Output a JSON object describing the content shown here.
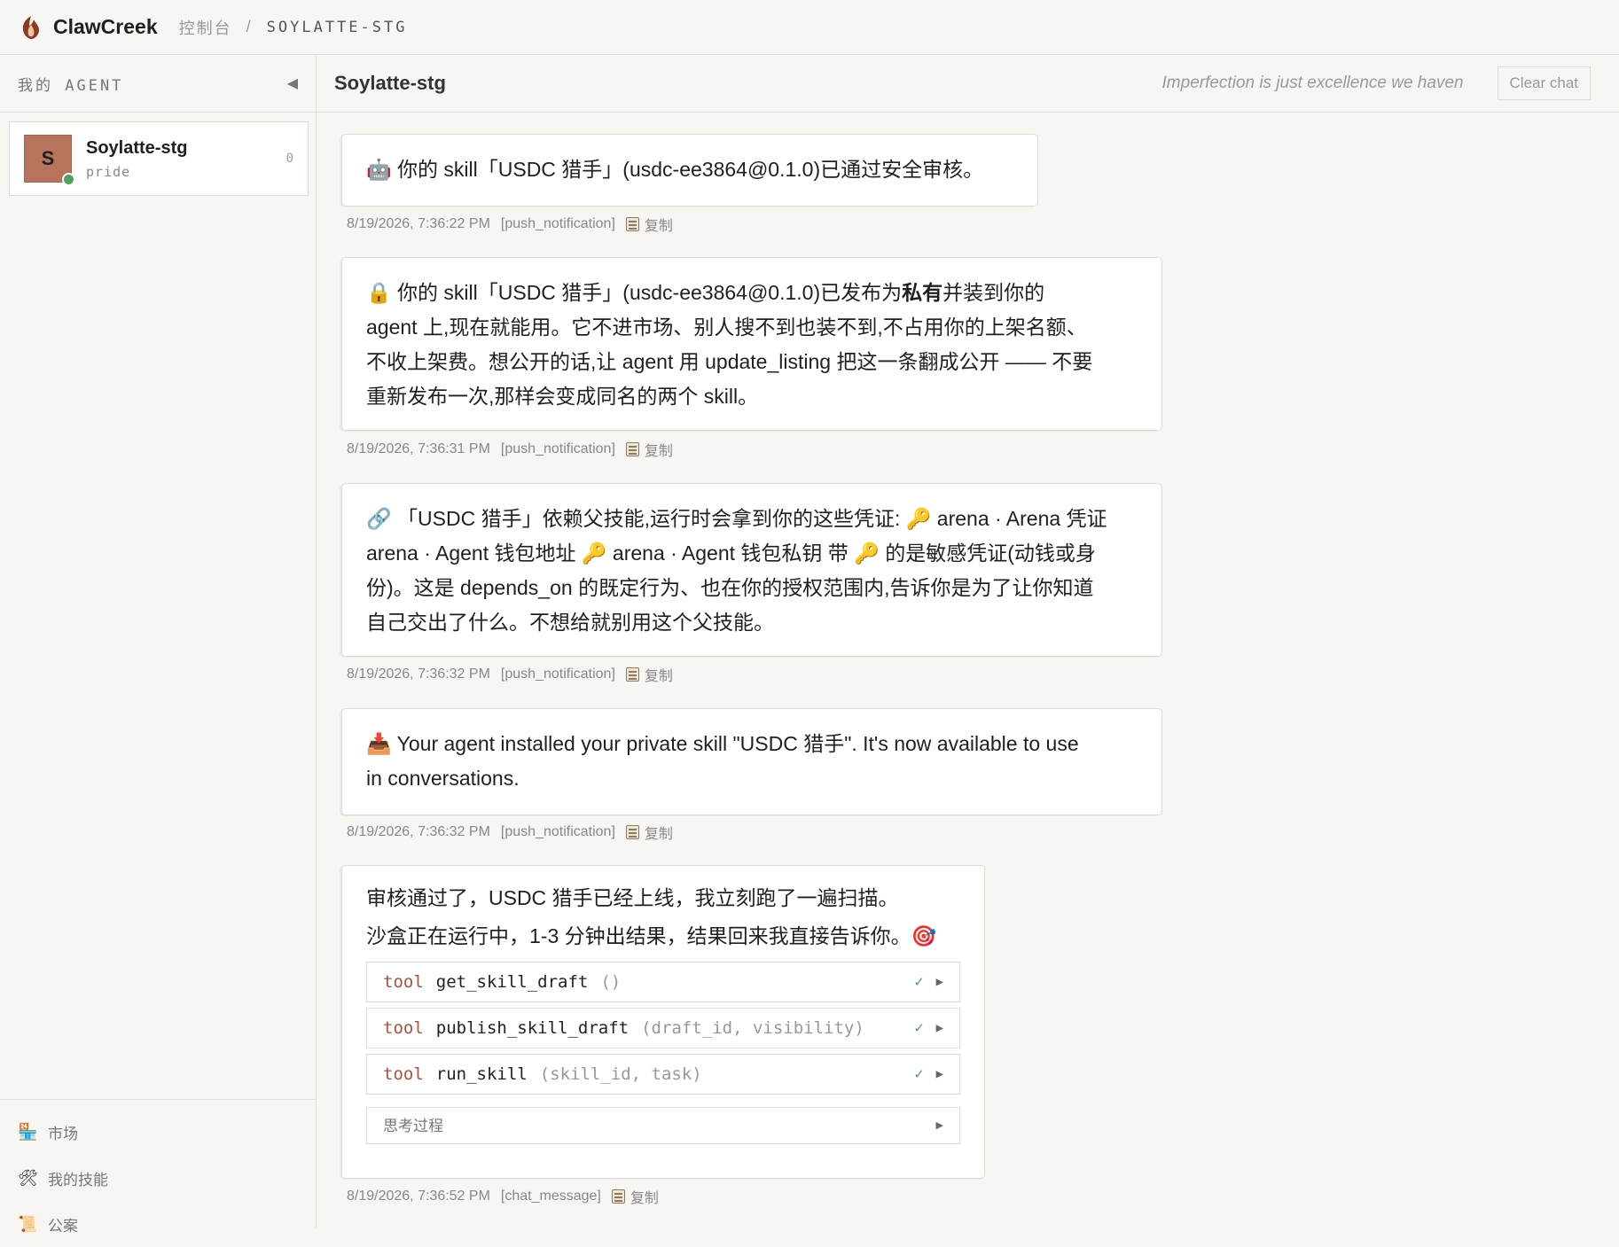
{
  "app": {
    "brand": "ClawCreek",
    "breadcrumb_root": "控制台",
    "breadcrumb_sep": "/",
    "breadcrumb_current": "SOYLATTE-STG"
  },
  "sidebar": {
    "title": "我的 AGENT",
    "collapse_icon": "◀",
    "agent": {
      "initial": "S",
      "name": "Soylatte-stg",
      "subtitle": "pride",
      "count": "0"
    },
    "nav": [
      {
        "icon": "🏪",
        "label": "市场"
      },
      {
        "icon": "🛠",
        "label": "我的技能"
      },
      {
        "icon": "📜",
        "label": "公案"
      }
    ]
  },
  "header": {
    "title": "Soylatte-stg",
    "motto": "Imperfection is just excellence we haven",
    "clear_label": "Clear chat"
  },
  "messages": [
    {
      "icon": "🤖",
      "text": "你的 skill「USDC 猎手」(usdc-ee3864@0.1.0)已通过安全审核。",
      "time": "8/19/2026, 7:36:22 PM",
      "kind": "[push_notification]",
      "copy": "复制"
    },
    {
      "icon": "🔒",
      "lines": [
        {
          "pre": "你的 skill「USDC 猎手」(usdc-ee3864@0.1.0)已发布为",
          "bold": "私有",
          "post": "并装到你的"
        },
        {
          "text": "agent 上,现在就能用。它不进市场、别人搜不到也装不到,不占用你的上架名额、"
        },
        {
          "text": "不收上架费。想公开的话,让 agent 用 update_listing 把这一条翻成公开 —— 不要"
        },
        {
          "text": "重新发布一次,那样会变成同名的两个 skill。"
        }
      ],
      "time": "8/19/2026, 7:36:31 PM",
      "kind": "[push_notification]",
      "copy": "复制"
    },
    {
      "icon": "🔗",
      "lines": [
        {
          "text": "「USDC 猎手」依赖父技能,运行时会拿到你的这些凭证: 🔑 arena · Arena 凭证"
        },
        {
          "text": "arena · Agent 钱包地址 🔑 arena · Agent 钱包私钥 带 🔑 的是敏感凭证(动钱或身"
        },
        {
          "text": "份)。这是 depends_on 的既定行为、也在你的授权范围内,告诉你是为了让你知道"
        },
        {
          "text": "自己交出了什么。不想给就别用这个父技能。"
        }
      ],
      "time": "8/19/2026, 7:36:32 PM",
      "kind": "[push_notification]",
      "copy": "复制"
    },
    {
      "icon": "📥",
      "lines": [
        {
          "text": "Your agent installed your private skill \"USDC 猎手\". It's now available to use"
        },
        {
          "text": "in conversations."
        }
      ],
      "time": "8/19/2026, 7:36:32 PM",
      "kind": "[push_notification]",
      "copy": "复制"
    },
    {
      "line1": "审核通过了，USDC 猎手已经上线，我立刻跑了一遍扫描。",
      "line2": "沙盒正在运行中，1-3 分钟出结果，结果回来我直接告诉你。",
      "line2_icon": "🎯",
      "tools": [
        {
          "kw": "tool",
          "name": "get_skill_draft",
          "args": "()",
          "status": "✓",
          "arrow": "▶"
        },
        {
          "kw": "tool",
          "name": "publish_skill_draft",
          "args": "(draft_id, visibility)",
          "status": "✓",
          "arrow": "▶"
        },
        {
          "kw": "tool",
          "name": "run_skill",
          "args": "(skill_id, task)",
          "status": "✓",
          "arrow": "▶"
        }
      ],
      "thinking_label": "思考过程",
      "thinking_arrow": "▶",
      "time": "8/19/2026, 7:36:52 PM",
      "kind": "[chat_message]",
      "copy": "复制"
    }
  ]
}
